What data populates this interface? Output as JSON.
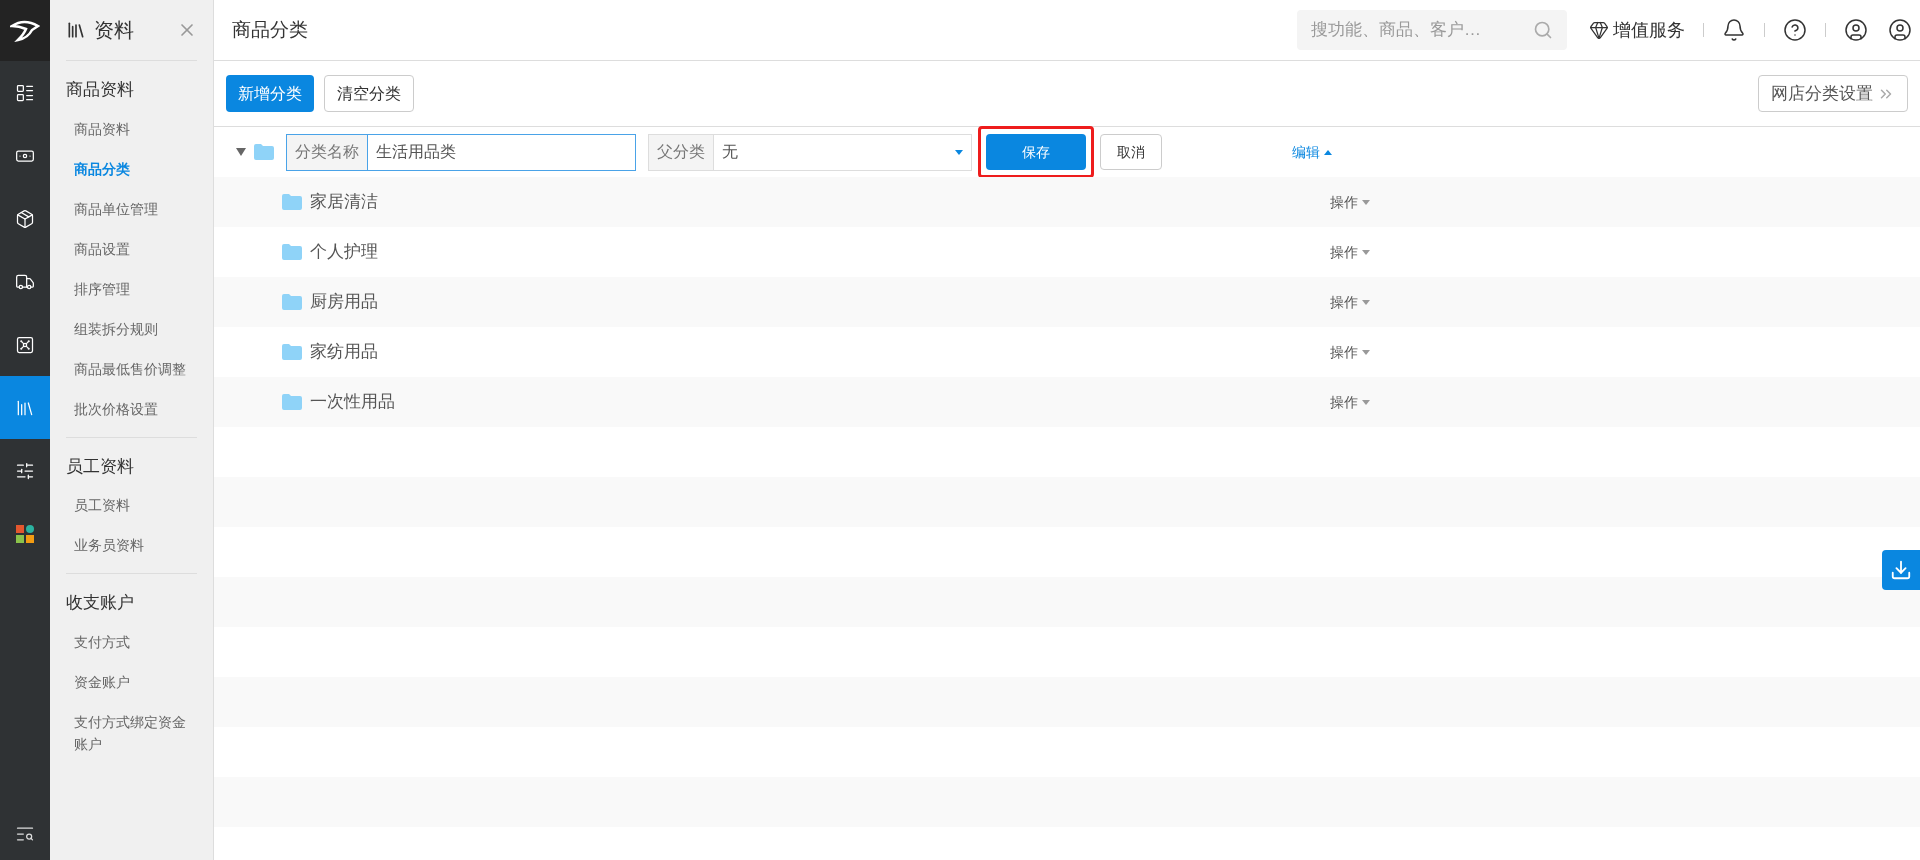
{
  "rail": {
    "items": [
      {
        "kind": "goods",
        "selected": false
      },
      {
        "kind": "money",
        "selected": false
      },
      {
        "kind": "box",
        "selected": false
      },
      {
        "kind": "truck",
        "selected": false
      },
      {
        "kind": "safe",
        "selected": false
      },
      {
        "kind": "books",
        "selected": true
      },
      {
        "kind": "sliders",
        "selected": false
      },
      {
        "kind": "apps",
        "selected": false
      }
    ]
  },
  "sidebar": {
    "title": "资料",
    "groups": [
      {
        "title": "商品资料",
        "items": [
          {
            "label": "商品资料",
            "selected": false
          },
          {
            "label": "商品分类",
            "selected": true
          },
          {
            "label": "商品单位管理",
            "selected": false
          },
          {
            "label": "商品设置",
            "selected": false
          },
          {
            "label": "排序管理",
            "selected": false
          },
          {
            "label": "组装拆分规则",
            "selected": false
          },
          {
            "label": "商品最低售价调整",
            "selected": false
          },
          {
            "label": "批次价格设置",
            "selected": false
          }
        ]
      },
      {
        "title": "员工资料",
        "items": [
          {
            "label": "员工资料",
            "selected": false
          },
          {
            "label": "业务员资料",
            "selected": false
          }
        ]
      },
      {
        "title": "收支账户",
        "items": [
          {
            "label": "支付方式",
            "selected": false
          },
          {
            "label": "资金账户",
            "selected": false
          },
          {
            "label": "支付方式绑定资金账户",
            "selected": false
          }
        ]
      }
    ]
  },
  "header": {
    "title": "商品分类",
    "search": {
      "placeholder": "搜功能、商品、客户…"
    },
    "vip": "增值服务"
  },
  "toolbar": {
    "add": "新增分类",
    "clear": "清空分类",
    "shop": "网店分类设置"
  },
  "edit_row": {
    "expanded": true,
    "name_label": "分类名称",
    "name_value": "生活用品类",
    "parent_label": "父分类",
    "parent_value": "无",
    "save": "保存",
    "cancel": "取消",
    "edit": "编辑",
    "highlighted": true
  },
  "rows": [
    {
      "name": "家居清洁",
      "action": "操作"
    },
    {
      "name": "个人护理",
      "action": "操作"
    },
    {
      "name": "厨房用品",
      "action": "操作"
    },
    {
      "name": "家纺用品",
      "action": "操作"
    },
    {
      "name": "一次性用品",
      "action": "操作"
    }
  ]
}
